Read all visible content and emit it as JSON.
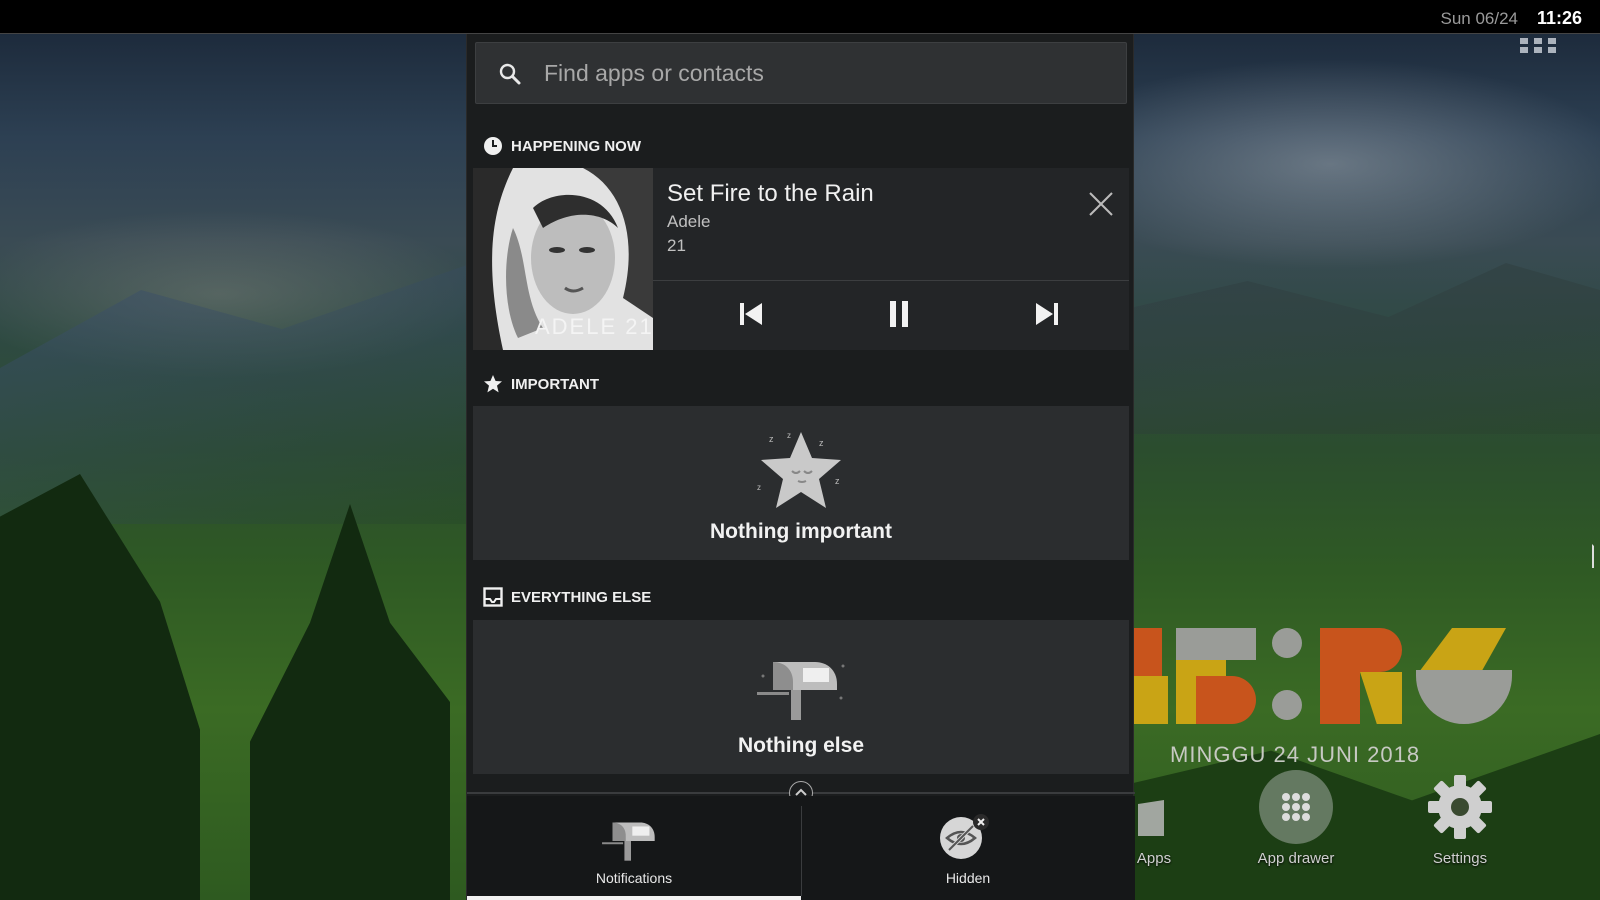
{
  "status_bar": {
    "date": "Sun 06/24",
    "time": "11:26"
  },
  "search": {
    "placeholder": "Find apps or contacts"
  },
  "sections": {
    "happening_now": "HAPPENING NOW",
    "important": "IMPORTANT",
    "everything_else": "EVERYTHING ELSE"
  },
  "now_playing": {
    "title": "Set Fire to the Rain",
    "artist": "Adele",
    "album": "21",
    "album_art_text": "ADELE 21",
    "state": "playing"
  },
  "important_card": {
    "label": "Nothing important"
  },
  "everything_else_card": {
    "label": "Nothing else"
  },
  "bottom_tabs": [
    {
      "label": "Notifications",
      "selected": true
    },
    {
      "label": "Hidden",
      "selected": false
    }
  ],
  "clock_widget": {
    "date": "MINGGU 24 JUNI 2018",
    "time": "11:26"
  },
  "dock": [
    {
      "label": "Apps",
      "icon": "apps-icon"
    },
    {
      "label": "App drawer",
      "icon": "app-drawer-icon"
    },
    {
      "label": "Settings",
      "icon": "gear-icon"
    }
  ],
  "colors": {
    "panel_bg": "#1b1d1e",
    "card_bg": "#2b2d2f",
    "clock_orange": "#c8541c",
    "clock_yellow": "#c9a415",
    "clock_grey": "#9a9c98"
  }
}
